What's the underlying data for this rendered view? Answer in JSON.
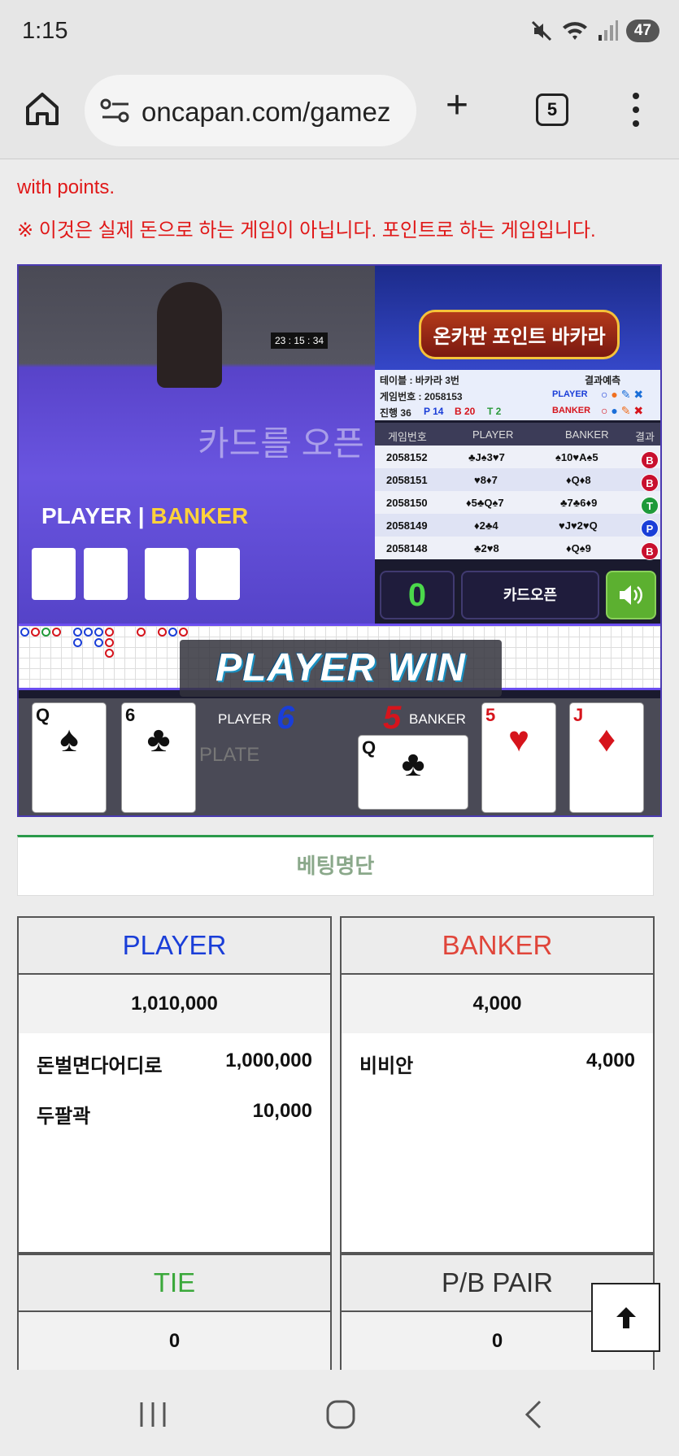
{
  "status": {
    "time": "1:15",
    "battery": "47"
  },
  "browser": {
    "url": "oncapan.com/gamez",
    "tab_count": "5"
  },
  "notice": {
    "line1": "with points.",
    "line2": "※ 이것은 실제 돈으로 하는 게임이 아닙니다. 포인트로 하는 게임입니다."
  },
  "video": {
    "clock": "23 : 15 : 34",
    "overlay": "카드를 오픈 합니다.",
    "player_label": "PLAYER",
    "banker_label": "BANKER"
  },
  "logo": {
    "title": "온카판 포인트 바카라"
  },
  "info": {
    "table": "테이블 : 바카라 3번",
    "game_no": "게임번호 : 2058153",
    "progress": "진행 36",
    "p": "P 14",
    "b": "B 20",
    "t": "T 2",
    "predict": "결과예측",
    "player": "PLAYER",
    "banker": "BANKER"
  },
  "history": {
    "headers": [
      "게임번호",
      "PLAYER",
      "BANKER",
      "결과"
    ],
    "rows": [
      {
        "no": "2058152",
        "player": "♣J♠3♥7",
        "banker": "♠10♥A♠5",
        "result": "B"
      },
      {
        "no": "2058151",
        "player": "♥8♦7",
        "banker": "♦Q♦8",
        "result": "B"
      },
      {
        "no": "2058150",
        "player": "♦5♣Q♠7",
        "banker": "♣7♣6♦9",
        "result": "T"
      },
      {
        "no": "2058149",
        "player": "♦2♣4",
        "banker": "♥J♥2♥Q",
        "result": "P"
      },
      {
        "no": "2058148",
        "player": "♣2♥8",
        "banker": "♦Q♠9",
        "result": "B"
      }
    ]
  },
  "controls": {
    "counter": "0",
    "open_button": "카드오픈"
  },
  "result": {
    "banner": "PLAYER WIN",
    "player_label": "PLAYER",
    "player_score": "6",
    "banker_label": "BANKER",
    "banker_score": "5",
    "plate": "PLATE"
  },
  "cards": {
    "p1": "Q",
    "p2": "6",
    "b1": "Q",
    "b2": "5",
    "b3": "J"
  },
  "bet_title": "베팅명단",
  "player_col": {
    "title": "PLAYER",
    "total": "1,010,000",
    "rows": [
      {
        "name": "돈벌면다어디로",
        "amount": "1,000,000"
      },
      {
        "name": "두팔곽",
        "amount": "10,000"
      }
    ]
  },
  "banker_col": {
    "title": "BANKER",
    "total": "4,000",
    "rows": [
      {
        "name": "비비안",
        "amount": "4,000"
      }
    ]
  },
  "tie_col": {
    "title": "TIE",
    "total": "0"
  },
  "pair_col": {
    "title": "P/B PAIR",
    "total": "0"
  },
  "colors": {
    "player": "#1a3ed8",
    "banker": "#e0453a",
    "tie": "#3aa83a",
    "notice": "#e01818"
  }
}
